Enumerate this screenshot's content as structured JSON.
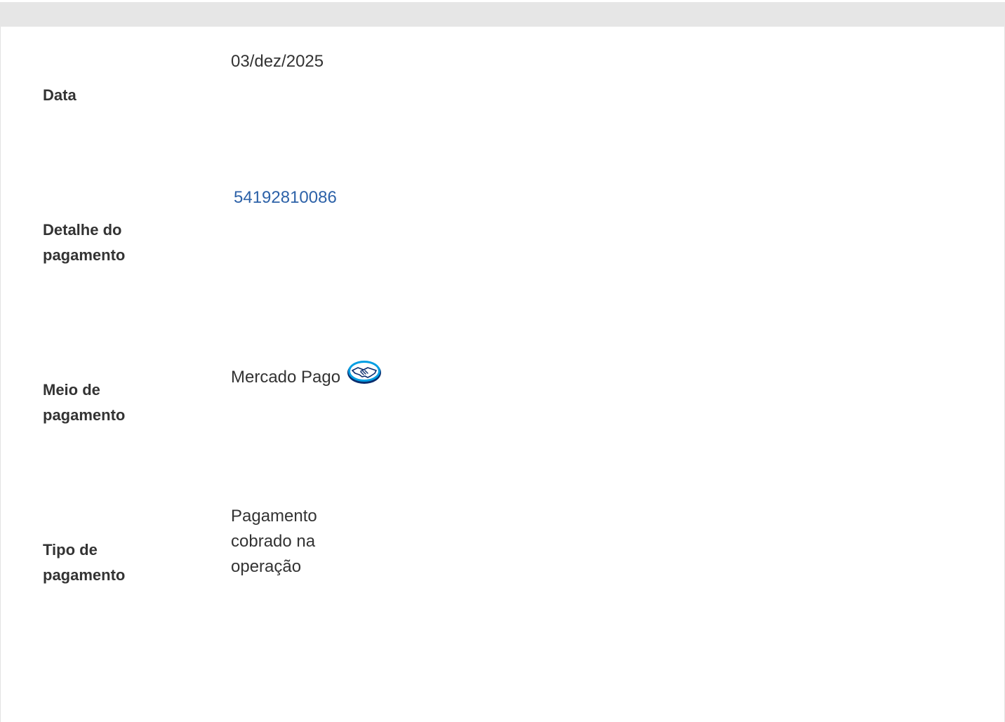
{
  "fields": {
    "data": {
      "label": "Data",
      "value": "03/dez/2025"
    },
    "detalhe": {
      "label": "Detalhe do pagamento",
      "value": "54192810086"
    },
    "meio": {
      "label": "Meio de pagamento",
      "value": "Mercado Pago",
      "icon": "mercado-pago-handshake-logo"
    },
    "tipo": {
      "label": "Tipo de pagamento",
      "value": "Pagamento cobrado na operação"
    }
  },
  "colors": {
    "link": "#2d62a8",
    "text": "#333333",
    "topbar": "#e6e6e6",
    "logo_blue": "#009ee3",
    "logo_dark": "#0c2e6e"
  }
}
